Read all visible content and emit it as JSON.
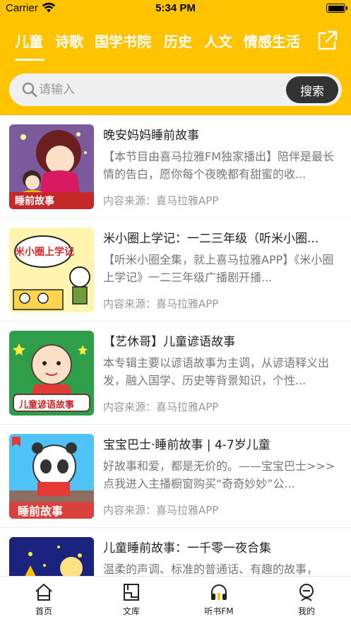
{
  "status": {
    "carrier": "Carrier",
    "time": "5:34 PM"
  },
  "tabs": [
    "儿童",
    "诗歌",
    "国学书院",
    "历史",
    "人文",
    "情感生活"
  ],
  "search": {
    "placeholder": "请输入",
    "button": "搜索"
  },
  "items": [
    {
      "title": "晚安妈妈睡前故事",
      "desc": "【本节目由喜马拉雅FM独家播出】陪伴是最长情的告白，愿你每个夜晚都有甜蜜的收...",
      "source": "内容来源：喜马拉雅APP",
      "badge": "睡前故事"
    },
    {
      "title": "米小圈上学记：一二三年级（听米小圈...",
      "desc": "【听米小圈全集，就上喜马拉雅APP】《米小圈上学记》一二三年级广播剧开播...",
      "source": "内容来源：喜马拉雅APP",
      "badge": "米小圈上学记"
    },
    {
      "title": "【艺休哥】儿童谚语故事",
      "desc": "本专辑主要以谚语故事为主调，从谚语释义出发，融入国学、历史等背景知识，个性...",
      "source": "内容来源：喜马拉雅APP",
      "badge": "儿童谚语故事"
    },
    {
      "title": "宝宝巴士·睡前故事 | 4-7岁儿童",
      "desc": "好故事和爱，都是无价的。——宝宝巴士>>>点我进入主播橱窗购买“奇奇妙妙”公...",
      "source": "内容来源：喜马拉雅APP",
      "badge": "睡前故事"
    },
    {
      "title": "儿童睡前故事：一千零一夜合集",
      "desc": "温柔的声调、标准的普通话、有趣的故事，",
      "source": "",
      "badge": ""
    }
  ],
  "tabbar": [
    "首页",
    "文库",
    "听书FM",
    "我的"
  ],
  "colors": {
    "accent": "#ffc300",
    "button": "#333333"
  }
}
